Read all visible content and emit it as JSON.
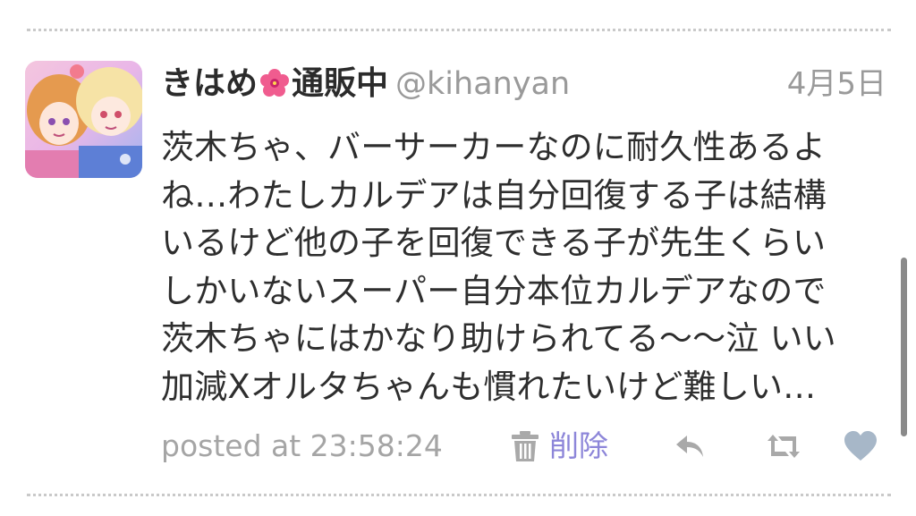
{
  "tweet": {
    "display_name_part1": "きはめ",
    "display_name_part2": "通販中",
    "username": "@kihanyan",
    "date": "4月5日",
    "body_lines": [
      "茨木ちゃ、バーサーカーなのに耐久性あるよ",
      "ね…わたしカルデアは自分回復する子は結構",
      "いるけど他の子を回復できる子が先生くらい",
      "しかいないスーパー自分本位カルデアなので",
      "茨木ちゃにはかなり助けられてる〜〜泣 いい",
      "加減Xオルタちゃんも慣れたいけど難しい…"
    ],
    "posted_at": "posted at 23:58:24",
    "delete_label": "削除"
  },
  "icons": {
    "avatar": "avatar-image",
    "name_emoji": "hibiscus-icon",
    "delete": "trash-icon",
    "reply": "reply-icon",
    "retweet": "retweet-icon",
    "favorite": "heart-icon"
  },
  "colors": {
    "text": "#2e2e2e",
    "muted": "#9a9a9a",
    "delete_accent": "#8d86d9",
    "icon_gray": "#a9a9a9",
    "heart": "#a7b7c8",
    "divider": "#c9c9c9"
  }
}
